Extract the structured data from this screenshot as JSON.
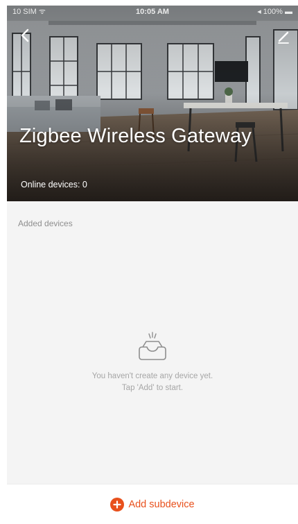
{
  "status_bar": {
    "carrier": "10 SIM ᯤ",
    "time": "10:05 AM",
    "battery": "◂ 100% ▬"
  },
  "header": {
    "back_icon": "chevron-left-icon",
    "edit_icon": "pencil-icon",
    "title": "Zigbee Wireless Gateway",
    "online_label": "Online devices: 0"
  },
  "devices": {
    "section_label": "Added devices",
    "items": [],
    "empty_icon": "empty-tray-icon",
    "empty_line_1": "You haven't create any device yet.",
    "empty_line_2": "Tap 'Add' to start."
  },
  "bottom": {
    "add_icon": "plus-circle-icon",
    "add_label": "Add subdevice"
  },
  "colors": {
    "accent": "#e8501c",
    "background": "#f4f4f4",
    "muted_text": "#8e8e8e"
  }
}
